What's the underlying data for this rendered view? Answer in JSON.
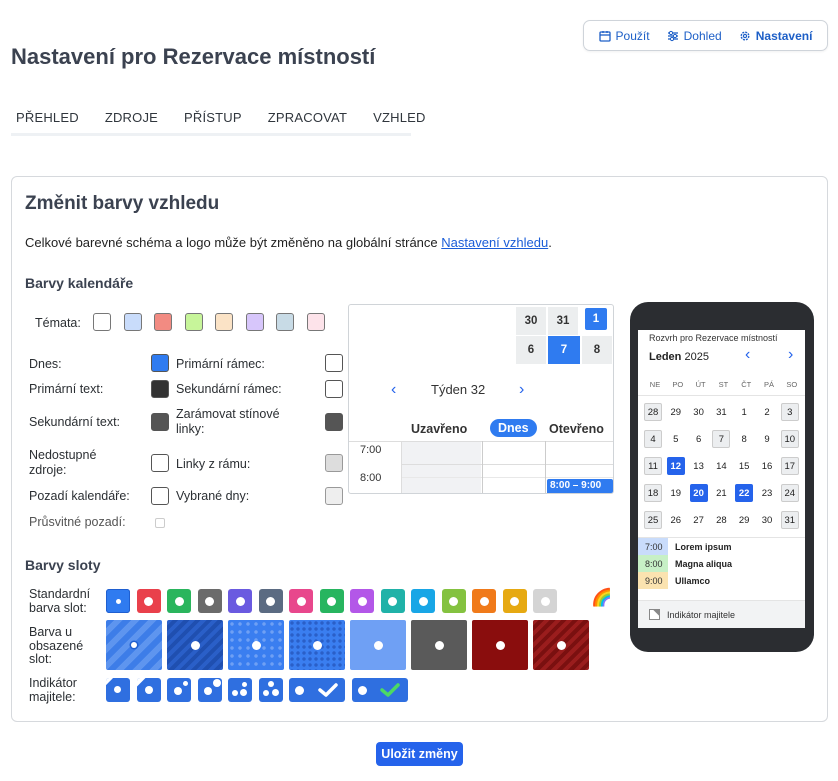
{
  "topnav": {
    "items": [
      {
        "label": "Použít",
        "icon": "calendar-icon"
      },
      {
        "label": "Dohled",
        "icon": "sliders-icon"
      },
      {
        "label": "Nastavení",
        "icon": "gear-icon"
      }
    ]
  },
  "page_title": "Nastavení pro Rezervace místností",
  "tabs": [
    "PŘEHLED",
    "ZDROJE",
    "PŘÍSTUP",
    "ZPRACOVAT",
    "VZHLED"
  ],
  "card": {
    "title": "Změnit barvy vzhledu",
    "intro": "Celkové barevné schéma a logo může být změněno na globální stránce ",
    "intro_link": "Nastavení vzhledu",
    "intro_end": "."
  },
  "calendar_colors": {
    "heading": "Barvy kalendáře",
    "themes_label": "Témata:",
    "themes": [
      "#ffffff",
      "#c9dcfb",
      "#f28b82",
      "#c7f59a",
      "#fbe3c6",
      "#d7c6fb",
      "#c8dbe6",
      "#fde3ea"
    ],
    "left": [
      {
        "label": "Dnes:",
        "color": "#2f7bf0"
      },
      {
        "label": "Primární text:",
        "color": "#333333"
      },
      {
        "label": "Sekundární text:",
        "color": "#555555"
      },
      {
        "label": "Nedostupné zdroje:",
        "color": "#ffffff"
      },
      {
        "label": "Pozadí kalendáře:",
        "color": "#ffffff"
      },
      {
        "label": "Průsvitné pozadí:",
        "color": ""
      }
    ],
    "right": [
      {
        "label": "Primární rámec:",
        "color": "#ffffff"
      },
      {
        "label": "Sekundární rámec:",
        "color": "#ffffff"
      },
      {
        "label": "Zarámovat stínové linky:",
        "color": "#555555"
      },
      {
        "label": "Linky z rámu:",
        "color": "#dddddd"
      },
      {
        "label": "Vybrané dny:",
        "color": "#eeeeee"
      }
    ]
  },
  "preview": {
    "mini_cal": [
      [
        "30",
        "31",
        "1"
      ],
      [
        "6",
        "7",
        "8"
      ]
    ],
    "week": "Týden 32",
    "columns": [
      "Uzavřeno",
      "Dnes",
      "Otevřeno"
    ],
    "times": [
      "7:00",
      "8:00"
    ],
    "event": "8:00 – 9:00"
  },
  "phone": {
    "title": "Rozvrh pro Rezervace místností",
    "month": "Leden",
    "year": "2025",
    "weekdays": [
      "NE",
      "PO",
      "ÚT",
      "ST",
      "ČT",
      "PÁ",
      "SO"
    ],
    "weeks": [
      [
        "28",
        "29",
        "30",
        "31",
        "1",
        "2",
        "3"
      ],
      [
        "4",
        "5",
        "6",
        "7",
        "8",
        "9",
        "10"
      ],
      [
        "11",
        "12",
        "13",
        "14",
        "15",
        "16",
        "17"
      ],
      [
        "18",
        "19",
        "20",
        "21",
        "22",
        "23",
        "24"
      ],
      [
        "25",
        "26",
        "27",
        "28",
        "29",
        "30",
        "31"
      ]
    ],
    "events": [
      {
        "time": "7:00",
        "name": "Lorem ipsum",
        "color": "#c9dcfb"
      },
      {
        "time": "8:00",
        "name": "Magna aliqua",
        "color": "#c7f0c6"
      },
      {
        "time": "9:00",
        "name": "Ullamco",
        "color": "#fbe3b0"
      }
    ],
    "owner_label": "Indikátor majitele"
  },
  "slot_colors": {
    "heading": "Barvy sloty",
    "standard_label": "Standardní barva slot:",
    "standard": [
      "#2f7bf0",
      "#e9404b",
      "#2ab55d",
      "#6b6b6b",
      "#6a5ae0",
      "#5b6b82",
      "#e8478c",
      "#27b55f",
      "#b357e8",
      "#20b2a8",
      "#18a6e6",
      "#84c240",
      "#f07a1a",
      "#e6a912",
      "#d4d4d4"
    ],
    "busy_label": "Barva u obsazené slot:",
    "busy": [
      "#3d7de8",
      "#2a5fc8",
      "#3a7ef0",
      "#3a7ef0",
      "#6fa0f4",
      "#5a5a5a",
      "#8a0d0d",
      "#9a1d1d"
    ],
    "owner_label": "Indikátor majitele:",
    "rainbow": "🌈"
  },
  "save_label": "Uložit změny"
}
